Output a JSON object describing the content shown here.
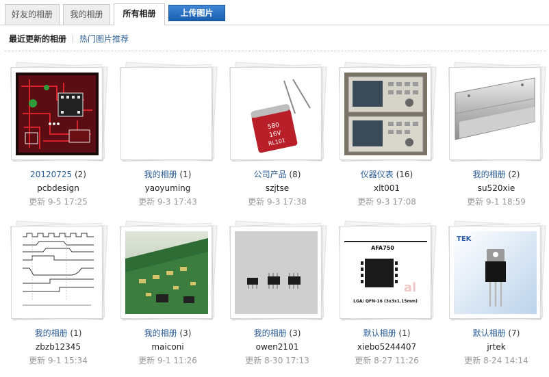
{
  "tabs": [
    {
      "label": "好友的相册"
    },
    {
      "label": "我的相册"
    },
    {
      "label": "所有相册"
    }
  ],
  "upload_label": "上传图片",
  "subnav": {
    "current": "最近更新的相册",
    "hot": "热门图片推荐"
  },
  "albums": [
    {
      "title": "20120725",
      "count": "(2)",
      "owner": "pcbdesign",
      "updated_prefix": "更新",
      "updated": "9-5 17:25",
      "thumb": "pcb-layout"
    },
    {
      "title": "我的相册",
      "count": "(1)",
      "owner": "yaoyuming",
      "updated_prefix": "更新",
      "updated": "9-3 17:43",
      "thumb": "blank"
    },
    {
      "title": "公司产品",
      "count": "(8)",
      "owner": "szjtse",
      "updated_prefix": "更新",
      "updated": "9-3 17:38",
      "thumb": "capacitor",
      "thumb_text": [
        "580",
        "16V",
        "RL101"
      ]
    },
    {
      "title": "仪器仪表",
      "count": "(16)",
      "owner": "xlt001",
      "updated_prefix": "更新",
      "updated": "9-3 17:08",
      "thumb": "instruments"
    },
    {
      "title": "我的相册",
      "count": "(2)",
      "owner": "su520xie",
      "updated_prefix": "更新",
      "updated": "9-1 18:59",
      "thumb": "metal-bar"
    },
    {
      "title": "我的相册",
      "count": "(1)",
      "owner": "zbzb12345",
      "updated_prefix": "更新",
      "updated": "9-1 15:34",
      "thumb": "timing-diagram"
    },
    {
      "title": "我的相册",
      "count": "(3)",
      "owner": "maiconi",
      "updated_prefix": "更新",
      "updated": "9-1 11:26",
      "thumb": "green-pcb"
    },
    {
      "title": "我的相册",
      "count": "(3)",
      "owner": "owen2101",
      "updated_prefix": "更新",
      "updated": "8-30 17:13",
      "thumb": "chips"
    },
    {
      "title": "默认相册",
      "count": "(1)",
      "owner": "xiebo5244407",
      "updated_prefix": "更新",
      "updated": "8-27 11:26",
      "thumb": "qfn-chip",
      "thumb_text": [
        "AFA750",
        "LGA/ QFN-16 (3x3x1.15mm)"
      ]
    },
    {
      "title": "默认相册",
      "count": "(7)",
      "owner": "jrtek",
      "updated_prefix": "更新",
      "updated": "8-24 14:14",
      "thumb": "transistor",
      "thumb_text": [
        "TEK"
      ]
    }
  ],
  "colors": {
    "link": "#2a5c94",
    "upload_button": "#2462b4",
    "muted": "#9a9a9a"
  }
}
